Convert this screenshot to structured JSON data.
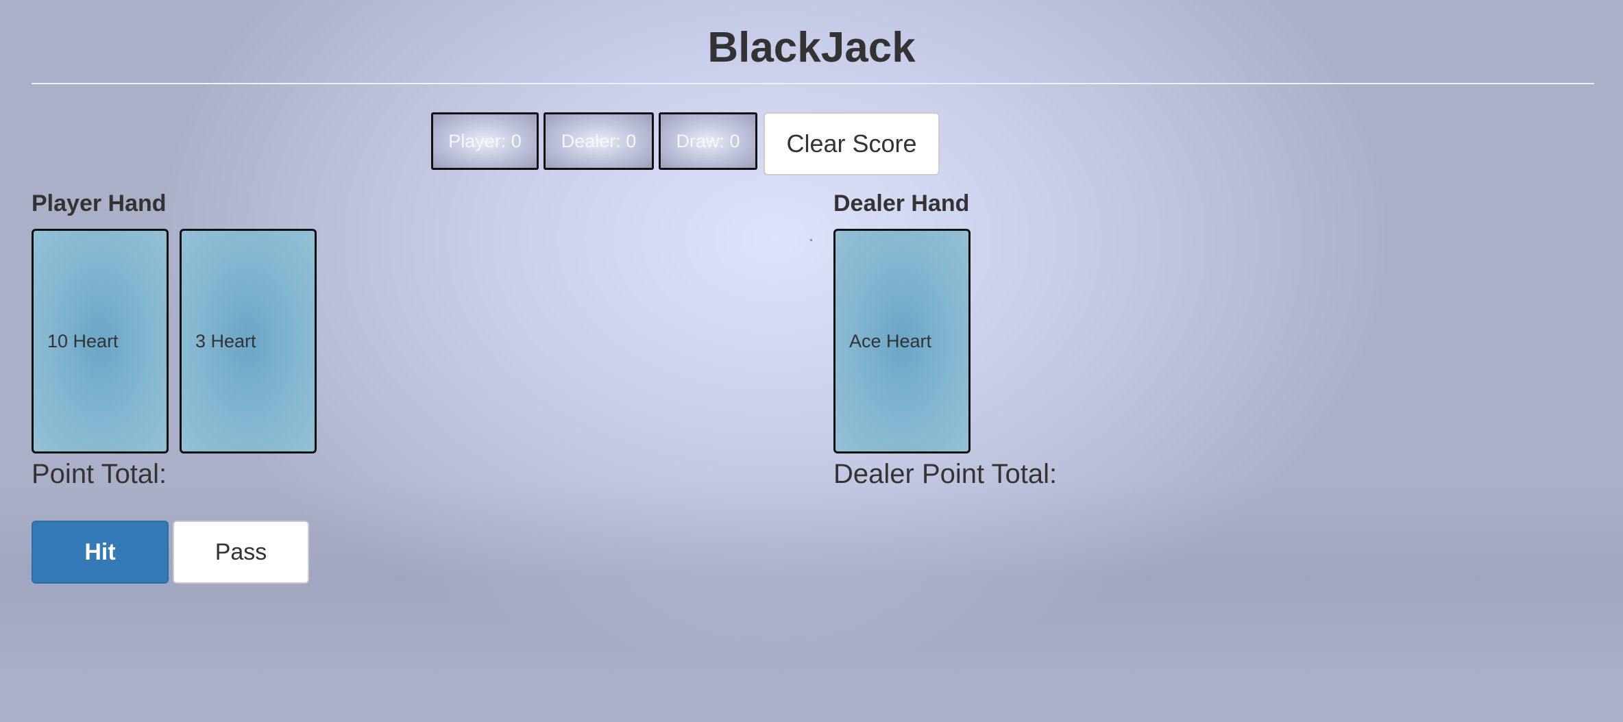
{
  "title": "BlackJack",
  "scoreboard": {
    "player": "Player: 0",
    "dealer": "Dealer: 0",
    "draw": "Draw: 0",
    "clear_label": "Clear Score"
  },
  "player": {
    "hand_label": "Player Hand",
    "cards": [
      "10 Heart",
      "3 Heart"
    ],
    "point_total_label": "Point Total:"
  },
  "dealer": {
    "hand_label": "Dealer Hand",
    "cards": [
      "Ace Heart"
    ],
    "point_total_label": "Dealer Point Total:"
  },
  "actions": {
    "hit_label": "Hit",
    "pass_label": "Pass"
  },
  "colors": {
    "primary_button": "#337ab7",
    "card_fill": "#84b7d0",
    "text": "#333333"
  }
}
